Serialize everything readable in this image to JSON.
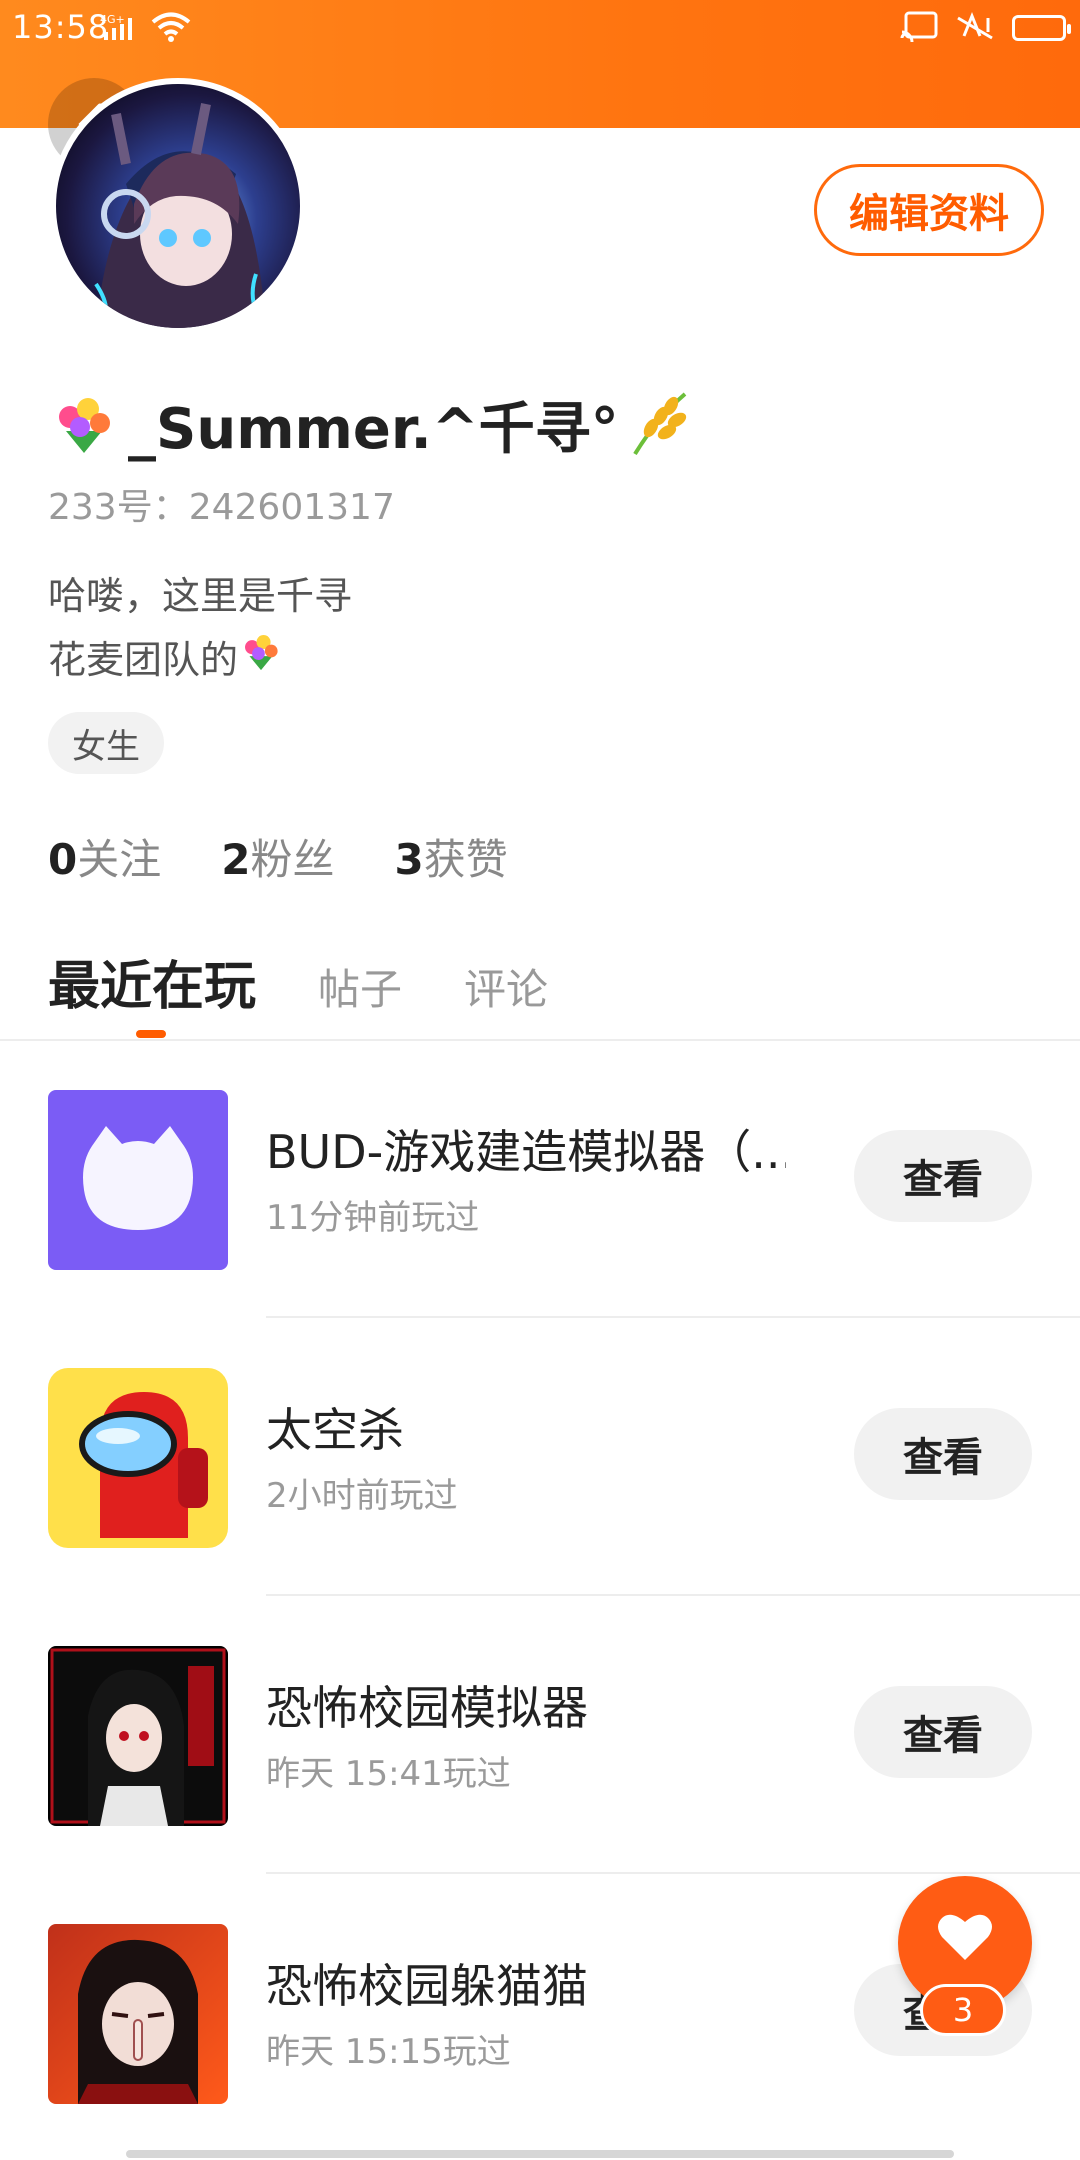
{
  "status_bar": {
    "time": "13:58",
    "network": "4G+"
  },
  "profile": {
    "edit_label": "编辑资料",
    "name": "_Summer.^千寻°",
    "uid_label": "233号：242601317",
    "bio_line1": "哈喽，这里是千寻",
    "bio_line2": "花麦团队的",
    "gender_tag": "女生"
  },
  "stats": [
    {
      "count": "0",
      "label": "关注"
    },
    {
      "count": "2",
      "label": "粉丝"
    },
    {
      "count": "3",
      "label": "获赞"
    }
  ],
  "tabs": [
    {
      "label": "最近在玩",
      "active": true
    },
    {
      "label": "帖子",
      "active": false
    },
    {
      "label": "评论",
      "active": false
    }
  ],
  "games": [
    {
      "title": "BUD-游戏建造模拟器（...",
      "played": "11分钟前玩过",
      "action": "查看"
    },
    {
      "title": "太空杀",
      "played": "2小时前玩过",
      "action": "查看"
    },
    {
      "title": "恐怖校园模拟器",
      "played": "昨天 15:41玩过",
      "action": "查看"
    },
    {
      "title": "恐怖校园躲猫猫",
      "played": "昨天 15:15玩过",
      "action": "查看"
    }
  ],
  "fab": {
    "badge": "3"
  },
  "colors": {
    "accent": "#ff5c00",
    "header": "#ff7a14"
  }
}
